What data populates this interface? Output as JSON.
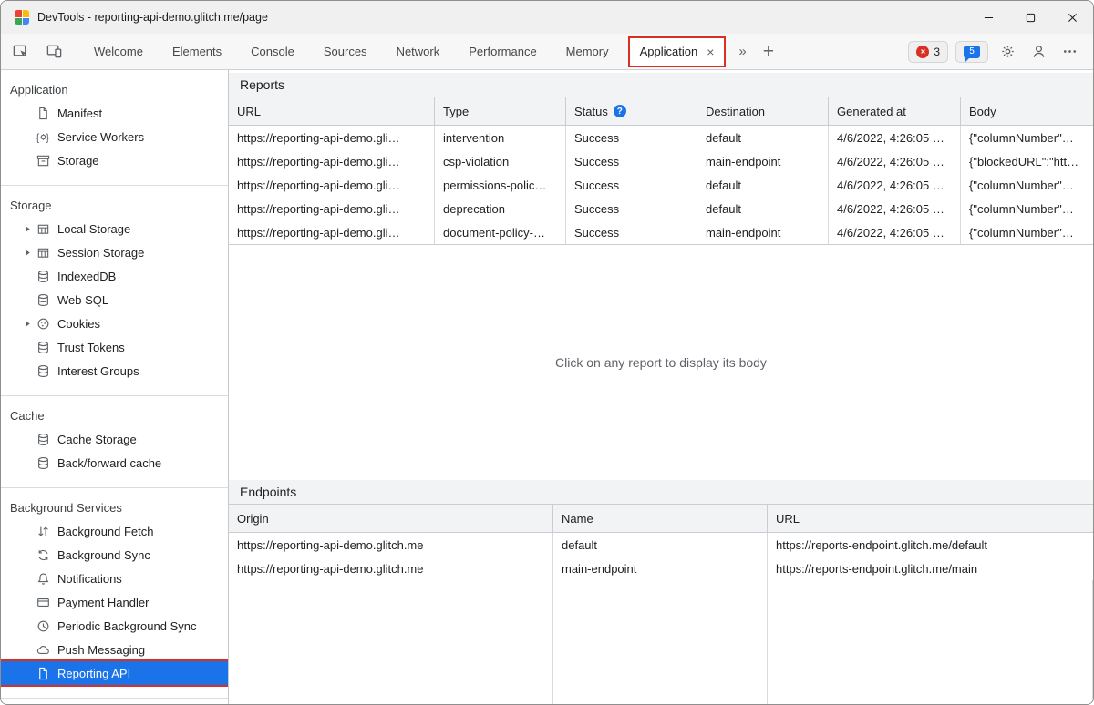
{
  "colors": {
    "selection_blue": "#1a73e8",
    "annotation_red": "#d93025",
    "error_badge_red": "#d93025",
    "issues_badge_blue": "#1a73e8",
    "help_icon_blue": "#1a73e8",
    "panel_header_gray": "#f1f3f4"
  },
  "window": {
    "title": "DevTools - reporting-api-demo.glitch.me/page"
  },
  "toolbar": {
    "tabs": [
      "Welcome",
      "Elements",
      "Console",
      "Sources",
      "Network",
      "Performance",
      "Memory",
      "Application"
    ],
    "active_tab": "Application",
    "tab_close_glyph": "×",
    "more_tabs_glyph": "»",
    "new_tab_glyph": "+",
    "error_count": "3",
    "issue_count": "5"
  },
  "sidebar": {
    "sections": [
      {
        "title": "Application",
        "items": [
          {
            "label": "Manifest",
            "icon": "document-icon"
          },
          {
            "label": "Service Workers",
            "icon": "service-workers-icon"
          },
          {
            "label": "Storage",
            "icon": "storage-box-icon"
          }
        ]
      },
      {
        "title": "Storage",
        "items": [
          {
            "label": "Local Storage",
            "icon": "table-icon",
            "expandable": true
          },
          {
            "label": "Session Storage",
            "icon": "table-icon",
            "expandable": true
          },
          {
            "label": "IndexedDB",
            "icon": "database-icon"
          },
          {
            "label": "Web SQL",
            "icon": "database-icon"
          },
          {
            "label": "Cookies",
            "icon": "cookie-icon",
            "expandable": true
          },
          {
            "label": "Trust Tokens",
            "icon": "database-icon"
          },
          {
            "label": "Interest Groups",
            "icon": "database-icon"
          }
        ]
      },
      {
        "title": "Cache",
        "items": [
          {
            "label": "Cache Storage",
            "icon": "database-icon"
          },
          {
            "label": "Back/forward cache",
            "icon": "database-icon"
          }
        ]
      },
      {
        "title": "Background Services",
        "items": [
          {
            "label": "Background Fetch",
            "icon": "fetch-arrows-icon"
          },
          {
            "label": "Background Sync",
            "icon": "sync-arrows-icon"
          },
          {
            "label": "Notifications",
            "icon": "bell-icon"
          },
          {
            "label": "Payment Handler",
            "icon": "payment-card-icon"
          },
          {
            "label": "Periodic Background Sync",
            "icon": "clock-icon"
          },
          {
            "label": "Push Messaging",
            "icon": "cloud-icon"
          },
          {
            "label": "Reporting API",
            "icon": "document-icon",
            "selected": true
          }
        ]
      }
    ]
  },
  "reports": {
    "title": "Reports",
    "columns": [
      "URL",
      "Type",
      "Status",
      "Destination",
      "Generated at",
      "Body"
    ],
    "status_help_glyph": "?",
    "rows": [
      {
        "url": "https://reporting-api-demo.gli…",
        "type": "intervention",
        "status": "Success",
        "destination": "default",
        "generated_at": "4/6/2022, 4:26:05 …",
        "body": "{\"columnNumber\"…"
      },
      {
        "url": "https://reporting-api-demo.gli…",
        "type": "csp-violation",
        "status": "Success",
        "destination": "main-endpoint",
        "generated_at": "4/6/2022, 4:26:05 …",
        "body": "{\"blockedURL\":\"htt…"
      },
      {
        "url": "https://reporting-api-demo.gli…",
        "type": "permissions-polic…",
        "status": "Success",
        "destination": "default",
        "generated_at": "4/6/2022, 4:26:05 …",
        "body": "{\"columnNumber\"…"
      },
      {
        "url": "https://reporting-api-demo.gli…",
        "type": "deprecation",
        "status": "Success",
        "destination": "default",
        "generated_at": "4/6/2022, 4:26:05 …",
        "body": "{\"columnNumber\"…"
      },
      {
        "url": "https://reporting-api-demo.gli…",
        "type": "document-policy-…",
        "status": "Success",
        "destination": "main-endpoint",
        "generated_at": "4/6/2022, 4:26:05 …",
        "body": "{\"columnNumber\"…"
      }
    ],
    "empty_message": "Click on any report to display its body"
  },
  "endpoints": {
    "title": "Endpoints",
    "columns": [
      "Origin",
      "Name",
      "URL"
    ],
    "rows": [
      {
        "origin": "https://reporting-api-demo.glitch.me",
        "name": "default",
        "url": "https://reports-endpoint.glitch.me/default"
      },
      {
        "origin": "https://reporting-api-demo.glitch.me",
        "name": "main-endpoint",
        "url": "https://reports-endpoint.glitch.me/main"
      }
    ]
  }
}
